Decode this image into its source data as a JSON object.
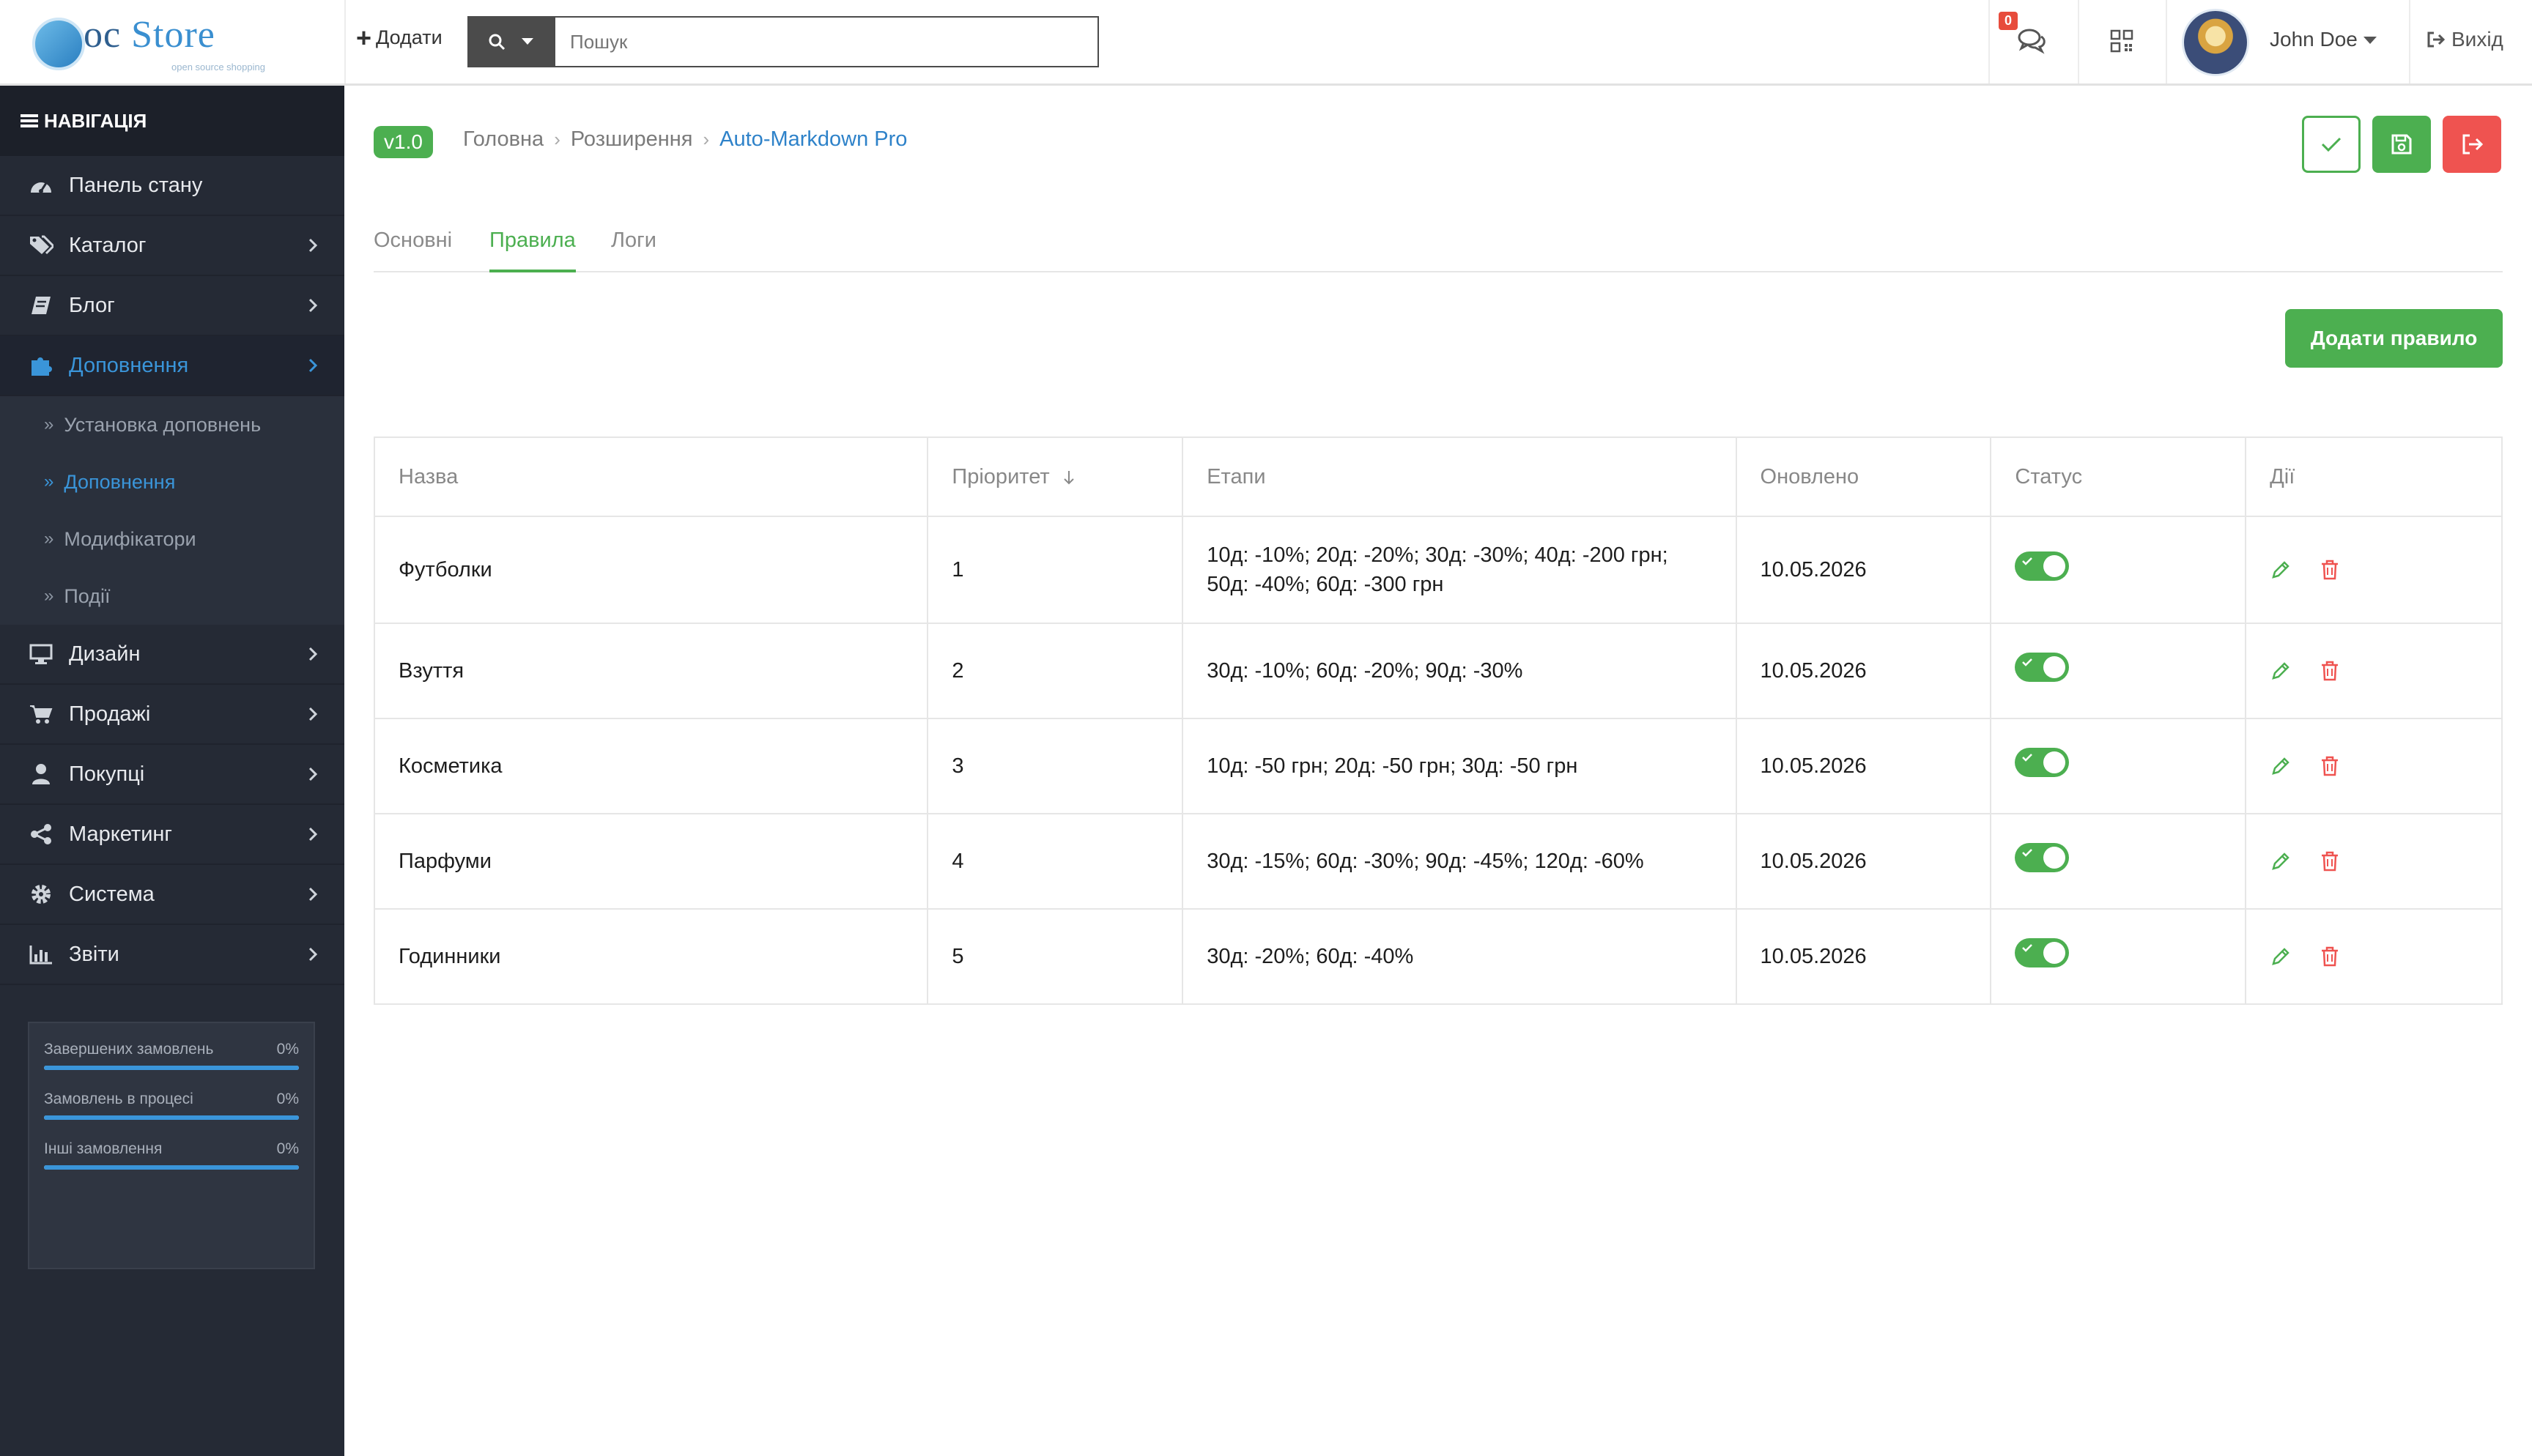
{
  "app": {
    "logo_text_1": "oc",
    "logo_text_2": "Store",
    "logo_tagline": "open source shopping"
  },
  "header": {
    "add_label": "Додати",
    "search_placeholder": "Пошук",
    "messages_count": "0",
    "user_name": "John Doe",
    "logout_label": "Вихід"
  },
  "sidebar": {
    "heading": "НАВІГАЦІЯ",
    "items": [
      {
        "label": "Панель стану",
        "icon": "dashboard-icon"
      },
      {
        "label": "Каталог",
        "icon": "tags-icon"
      },
      {
        "label": "Блог",
        "icon": "book-icon"
      },
      {
        "label": "Доповнення",
        "icon": "puzzle-icon"
      },
      {
        "label": "Дизайн",
        "icon": "monitor-icon"
      },
      {
        "label": "Продажі",
        "icon": "cart-icon"
      },
      {
        "label": "Покупці",
        "icon": "user-icon"
      },
      {
        "label": "Маркетинг",
        "icon": "share-icon"
      },
      {
        "label": "Система",
        "icon": "gear-icon"
      },
      {
        "label": "Звіти",
        "icon": "bar-chart-icon"
      }
    ],
    "sub_items": [
      {
        "label": "Установка доповнень"
      },
      {
        "label": "Доповнення"
      },
      {
        "label": "Модифікатори"
      },
      {
        "label": "Події"
      }
    ],
    "stats": [
      {
        "label": "Завершених замовлень",
        "value": "0%",
        "fraction": 1.0
      },
      {
        "label": "Замовлень в процесі",
        "value": "0%",
        "fraction": 1.0
      },
      {
        "label": "Інші замовлення",
        "value": "0%",
        "fraction": 1.0
      }
    ]
  },
  "page": {
    "version": "v1.0",
    "breadcrumb": [
      "Головна",
      "Розширення",
      "Auto-Markdown Pro"
    ],
    "tabs": [
      "Основні",
      "Правила",
      "Логи"
    ],
    "active_tab": "Правила",
    "add_rule_label": "Додати правило"
  },
  "colors": {
    "accent_green": "#4caf50",
    "danger_red": "#ef5350",
    "link_blue": "#2e82c9",
    "sidebar_bg": "#252a35"
  },
  "table": {
    "columns": [
      "Назва",
      "Пріоритет",
      "Етапи",
      "Оновлено",
      "Статус",
      "Дії"
    ],
    "sorted_by": "Пріоритет",
    "rows": [
      {
        "name": "Футболки",
        "priority": "1",
        "stages_line1": "10д: -10%; 20д: -20%; 30д: -30%; 40д: -200 грн;",
        "stages_line2": "50д: -40%; 60д: -300 грн",
        "updated": "10.05.2026",
        "status": true
      },
      {
        "name": "Взуття",
        "priority": "2",
        "stages_line1": "30д: -10%; 60д: -20%; 90д: -30%",
        "stages_line2": "",
        "updated": "10.05.2026",
        "status": true
      },
      {
        "name": "Косметика",
        "priority": "3",
        "stages_line1": "10д: -50 грн; 20д: -50 грн; 30д: -50 грн",
        "stages_line2": "",
        "updated": "10.05.2026",
        "status": true
      },
      {
        "name": "Парфуми",
        "priority": "4",
        "stages_line1": "30д: -15%; 60д: -30%; 90д: -45%; 120д: -60%",
        "stages_line2": "",
        "updated": "10.05.2026",
        "status": true
      },
      {
        "name": "Годинники",
        "priority": "5",
        "stages_line1": "30д: -20%; 60д: -40%",
        "stages_line2": "",
        "updated": "10.05.2026",
        "status": true
      }
    ]
  }
}
